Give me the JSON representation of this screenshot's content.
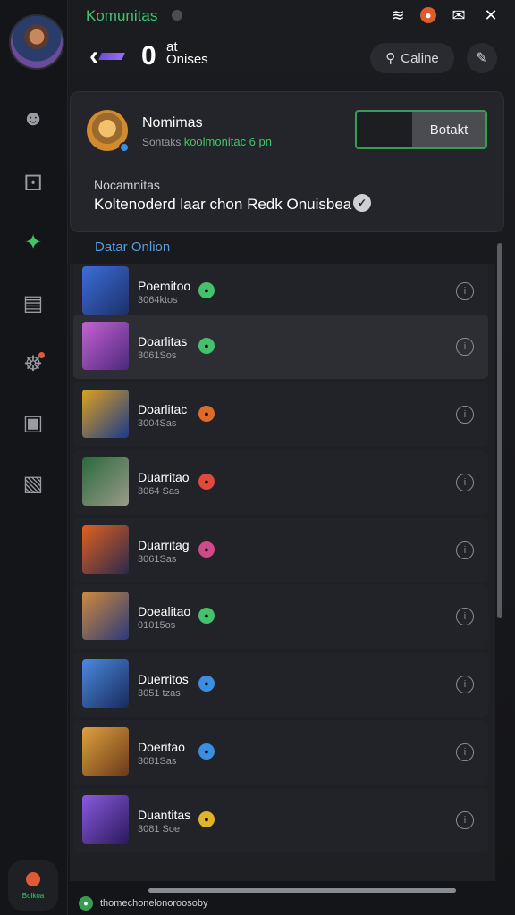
{
  "app": {
    "title": "Komunitas"
  },
  "status": {
    "icons": [
      "wifi-icon",
      "notification-icon",
      "chat-icon",
      "close-icon"
    ]
  },
  "header": {
    "count": "0",
    "line1": "at",
    "line2": "Onises",
    "search_label": "Caline"
  },
  "profile": {
    "name": "Nomimas",
    "sub_prefix": "Sontaks",
    "sub_highlight": "koolmonitac 6 pn",
    "action_label": "Botakt",
    "label": "Nocamnitas",
    "description": "Koltenoderd laar chon Redk Onuisbea"
  },
  "section": {
    "label": "Datar Onlion"
  },
  "rail": {
    "bottom_label": "Bolkoa"
  },
  "items": [
    {
      "title": "Poemitoo",
      "sub": "3064ktos",
      "badge_color": "#43c26b"
    },
    {
      "title": "Doarlitas",
      "sub": "3061Sos",
      "badge_color": "#43c26b"
    },
    {
      "title": "Doarlitac",
      "sub": "3004Sas",
      "badge_color": "#e06a2a"
    },
    {
      "title": "Duarritao",
      "sub": "3064 Sas",
      "badge_color": "#e04a3a"
    },
    {
      "title": "Duarritag",
      "sub": "3061Sas",
      "badge_color": "#d04a8a"
    },
    {
      "title": "Doealitao",
      "sub": "01015os",
      "badge_color": "#43c26b"
    },
    {
      "title": "Duerritos",
      "sub": "3051 tzas",
      "badge_color": "#3b8fe0"
    },
    {
      "title": "Doeritao",
      "sub": "3081Sas",
      "badge_color": "#3b8fe0"
    },
    {
      "title": "Duantitas",
      "sub": "3081 Soe",
      "badge_color": "#e0b42a"
    }
  ],
  "footer": {
    "text": "thomechonelonoroosoby"
  }
}
